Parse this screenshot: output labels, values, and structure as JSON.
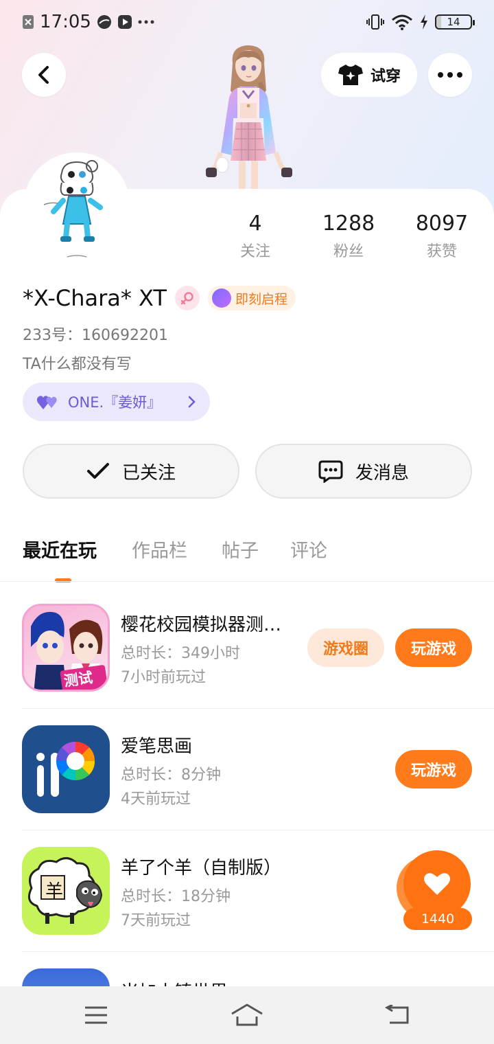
{
  "status_bar": {
    "time": "17:05",
    "battery": "14"
  },
  "header": {
    "tryon_label": "试穿"
  },
  "profile": {
    "stats": [
      {
        "value": "4",
        "label": "关注"
      },
      {
        "value": "1288",
        "label": "粉丝"
      },
      {
        "value": "8097",
        "label": "获赞"
      }
    ],
    "name": "*X-Chara* XT",
    "event_badge": "即刻启程",
    "uid": "233号：160692201",
    "bio": "TA什么都没有写",
    "couple": "ONE.『姜妍』"
  },
  "actions": {
    "followed_label": "已关注",
    "message_label": "发消息"
  },
  "tabs": [
    "最近在玩",
    "作品栏",
    "帖子",
    "评论"
  ],
  "games": [
    {
      "title": "樱花校园模拟器测…",
      "duration": "总时长：349小时",
      "last": "7小时前玩过",
      "circle_label": "游戏圈",
      "play_label": "玩游戏",
      "icon_text": "测试版"
    },
    {
      "title": "爱笔思画",
      "duration": "总时长：8分钟",
      "last": "4天前玩过",
      "play_label": "玩游戏"
    },
    {
      "title": "羊了个羊（自制版）",
      "duration": "总时长：18分钟",
      "last": "7天前玩过",
      "icon_text": "羊"
    },
    {
      "title": "米加小镇世界"
    }
  ],
  "floating_like": {
    "count": "1440"
  },
  "colors": {
    "accent": "#ff7a1a",
    "couple_chip": "#ebe8fb"
  }
}
